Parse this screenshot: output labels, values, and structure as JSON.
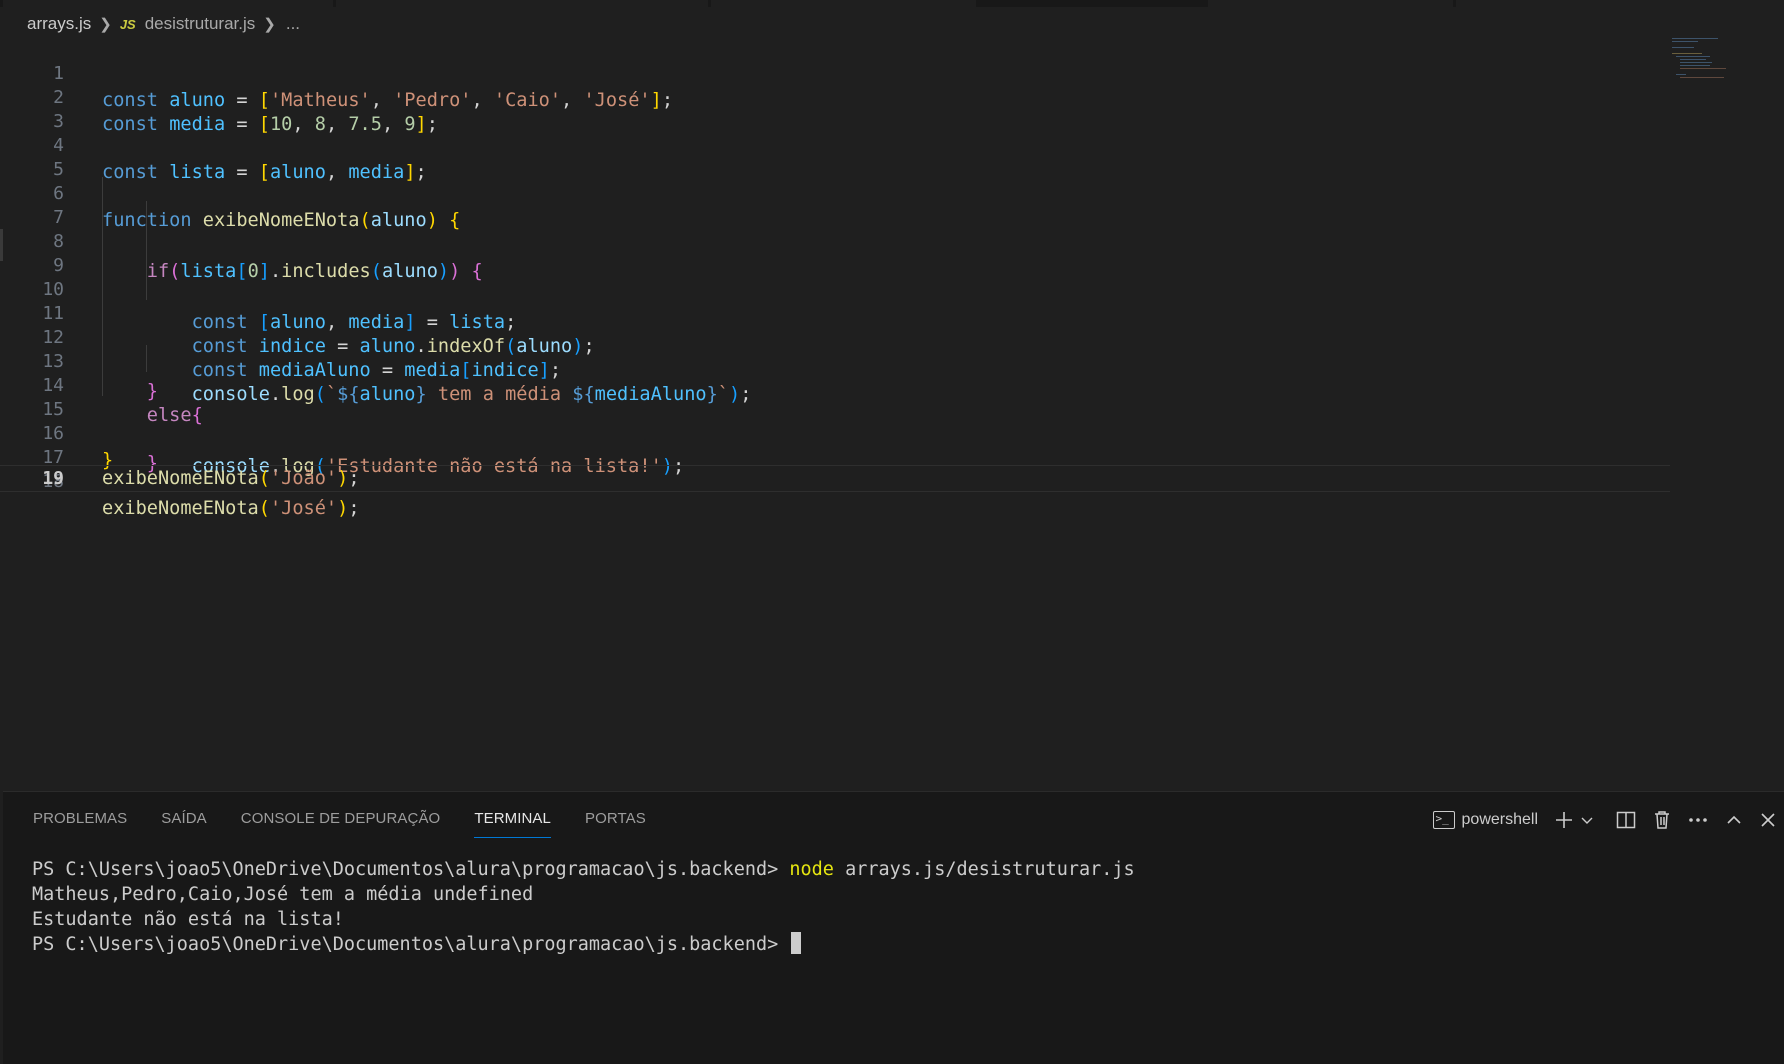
{
  "breadcrumb": {
    "folder": "arrays.js",
    "file_icon": "JS",
    "file": "desistruturar.js",
    "ellipsis": "..."
  },
  "editor": {
    "active_line": 19,
    "lines": [
      {
        "n": "1"
      },
      {
        "n": "2"
      },
      {
        "n": "3"
      },
      {
        "n": "4"
      },
      {
        "n": "5"
      },
      {
        "n": "6"
      },
      {
        "n": "7"
      },
      {
        "n": "8"
      },
      {
        "n": "9"
      },
      {
        "n": "10"
      },
      {
        "n": "11"
      },
      {
        "n": "12"
      },
      {
        "n": "13"
      },
      {
        "n": "14"
      },
      {
        "n": "15"
      },
      {
        "n": "16"
      },
      {
        "n": "17"
      },
      {
        "n": "18"
      },
      {
        "n": "19"
      }
    ],
    "tokens": {
      "const": "const",
      "function": "function",
      "if": "if",
      "else": "else",
      "aluno": "aluno",
      "media": "media",
      "lista": "lista",
      "indice": "indice",
      "mediaAluno": "mediaAluno",
      "fn_exibe": "exibeNomeENota",
      "includes": "includes",
      "indexOf": "indexOf",
      "console": "console",
      "log": "log",
      "s_matheus": "'Matheus'",
      "s_pedro": "'Pedro'",
      "s_caio": "'Caio'",
      "s_jose": "'José'",
      "s_joao": "'João'",
      "s_nao_esta": "'Estudante não está na lista!'",
      "tpl_mid": " tem a média ",
      "n10": "10",
      "n8": "8",
      "n75": "7.5",
      "n9": "9",
      "n0": "0"
    }
  },
  "panel": {
    "tabs": [
      "PROBLEMAS",
      "SAÍDA",
      "CONSOLE DE DEPURAÇÃO",
      "TERMINAL",
      "PORTAS"
    ],
    "active_tab": "TERMINAL",
    "shell_name": "powershell",
    "icons": [
      "terminal-icon",
      "plus-icon",
      "chevron-down-icon",
      "split-icon",
      "trash-icon",
      "more-icon",
      "chevron-up-icon",
      "close-icon"
    ]
  },
  "terminal": {
    "prompt": "PS C:\\Users\\joao5\\OneDrive\\Documentos\\alura\\programacao\\js.backend> ",
    "command_name": "node",
    "command_args": " arrays.js/desistruturar.js",
    "output_1": "Matheus,Pedro,Caio,José tem a média undefined",
    "output_2": "Estudante não está na lista!",
    "prompt2": "PS C:\\Users\\joao5\\OneDrive\\Documentos\\alura\\programacao\\js.backend> "
  },
  "colors": {
    "background": "#1f1f1f",
    "panel": "#181818",
    "keyword": "#569cd6",
    "variable": "#4fc1ff",
    "function": "#dcdcaa",
    "string": "#ce9178",
    "number": "#b5cea8",
    "accent": "#0078d4"
  }
}
